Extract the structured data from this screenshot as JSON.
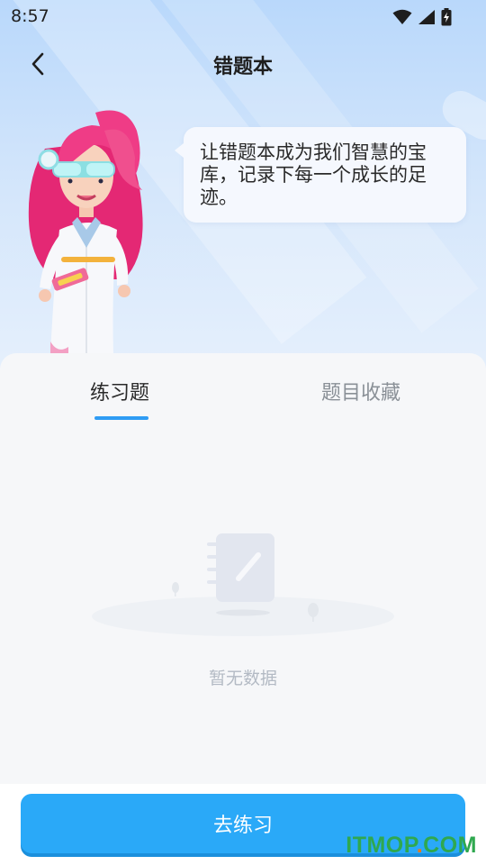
{
  "status_bar": {
    "time": "8:57",
    "icons": [
      "wifi-icon",
      "signal-icon",
      "battery-charging-icon"
    ]
  },
  "header": {
    "title": "错题本",
    "back_icon": "chevron-left-icon"
  },
  "bubble": {
    "text": "让错题本成为我们智慧的宝库，记录下每一个成长的足迹。"
  },
  "tabs": [
    {
      "label": "练习题",
      "active": true
    },
    {
      "label": "题目收藏",
      "active": false
    }
  ],
  "empty_state": {
    "icon": "notebook-pen-icon",
    "text": "暂无数据"
  },
  "action": {
    "label": "去练习"
  },
  "watermark": {
    "brand": "ITMOP",
    "dot": ".",
    "tld": "COM"
  },
  "colors": {
    "accent": "#2aa9f8",
    "tab_indicator": "#2f9cf4",
    "watermark_green": "#2fa84f",
    "watermark_orange": "#e87b1c"
  }
}
